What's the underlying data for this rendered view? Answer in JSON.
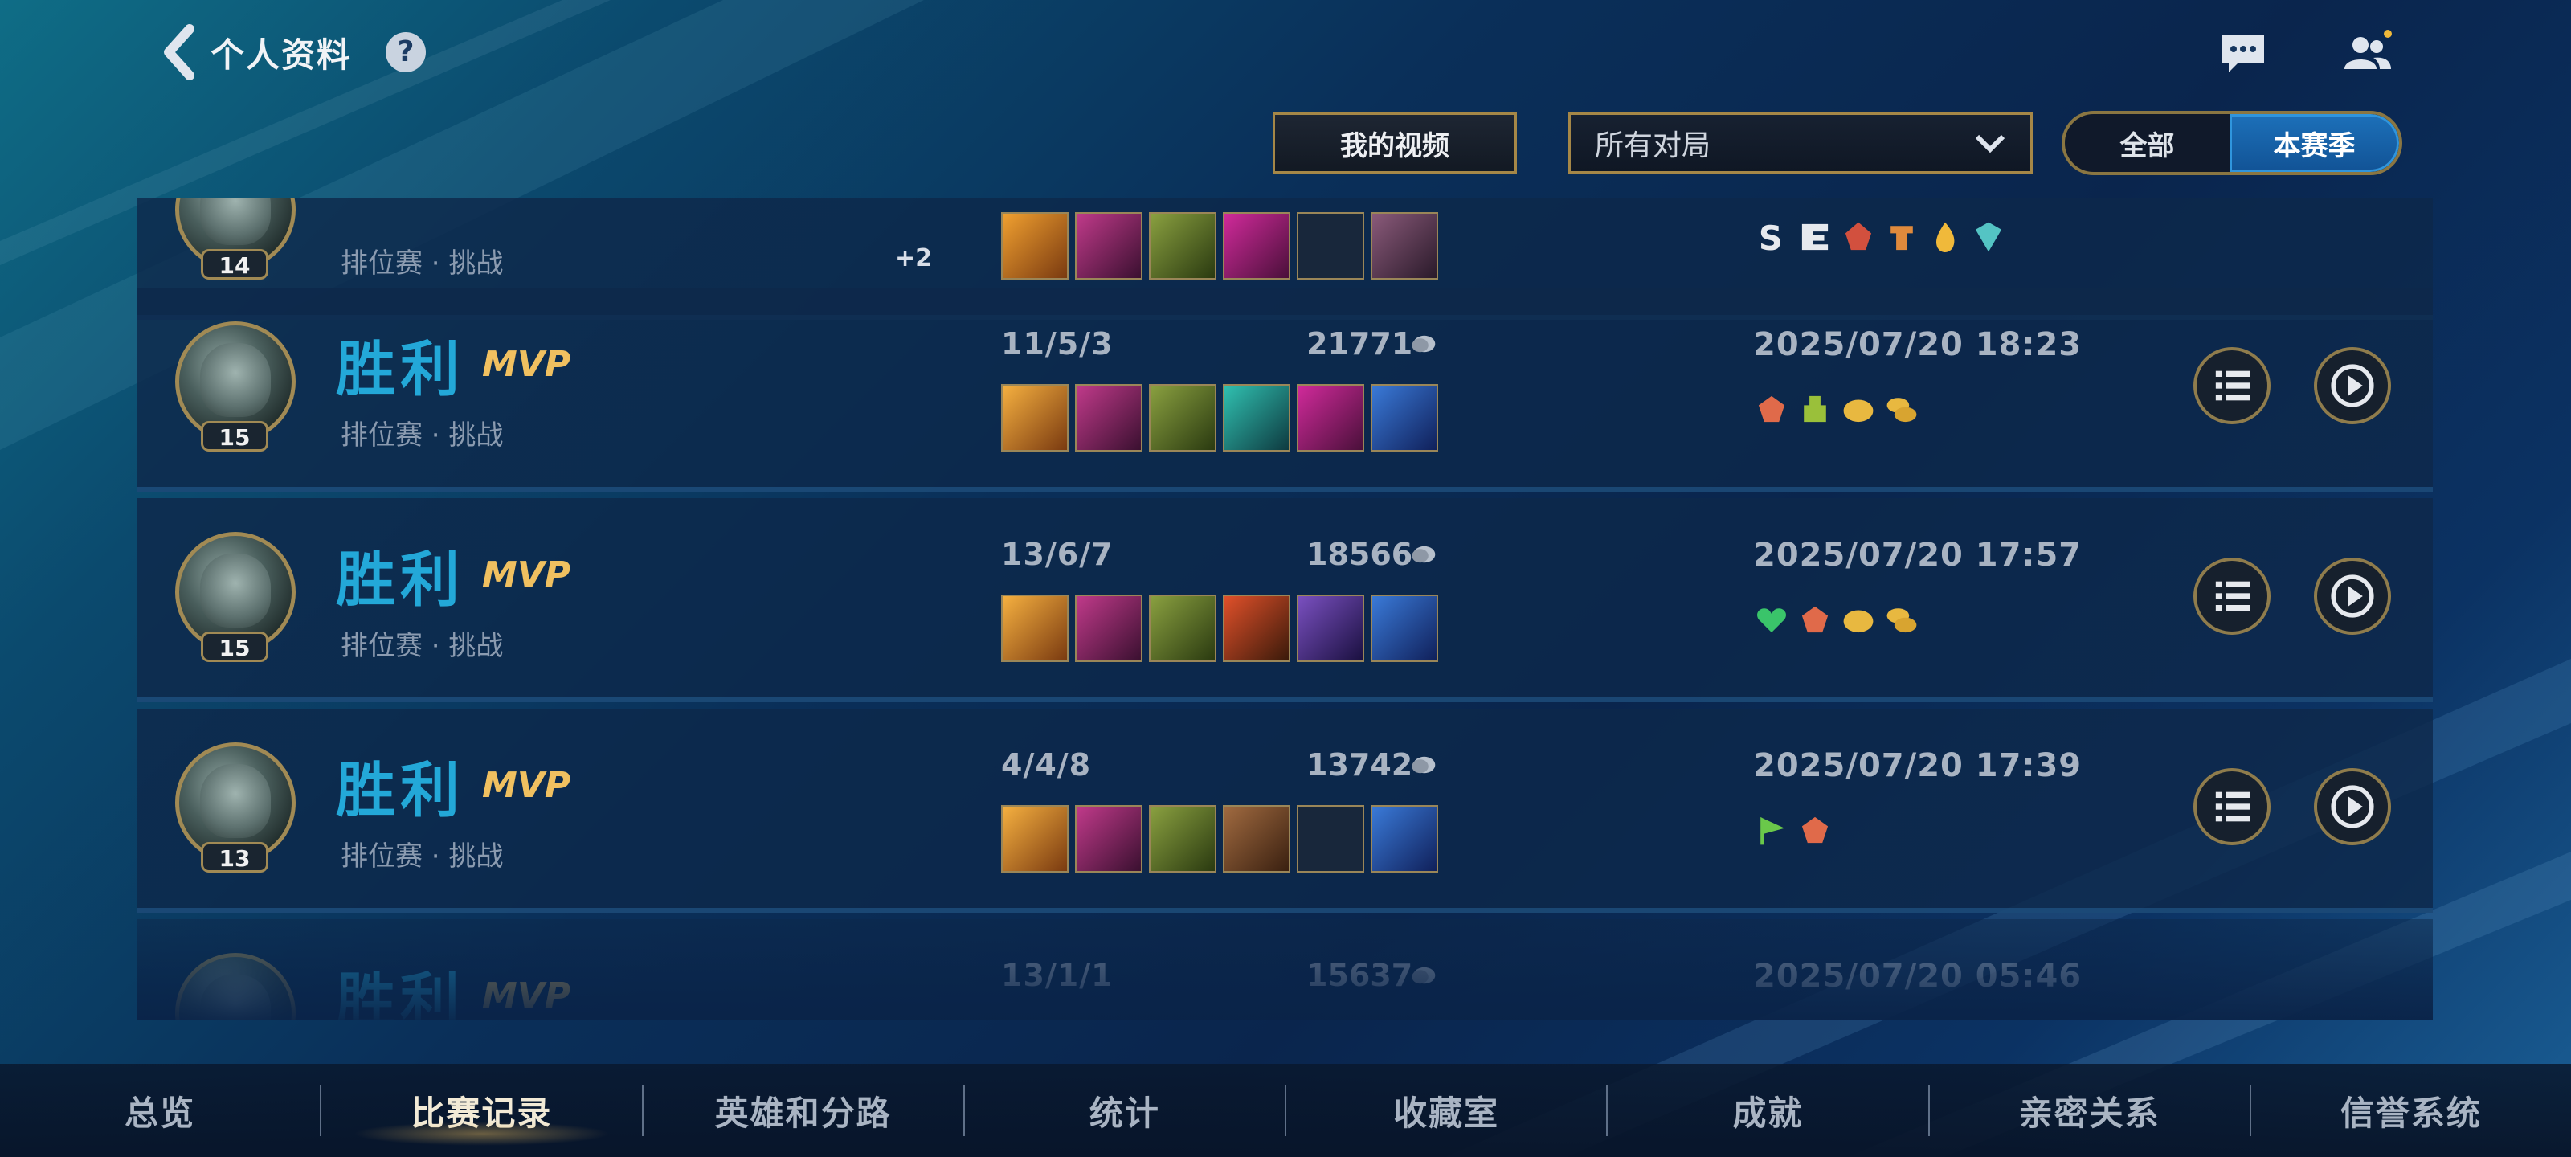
{
  "header": {
    "back_label": "个人资料",
    "help_glyph": "?"
  },
  "toolbar": {
    "my_videos": "我的视频",
    "filter_value": "所有对局",
    "season_all": "全部",
    "season_current": "本赛季"
  },
  "matches": [
    {
      "result": "",
      "mvp": "",
      "mode": "排位赛 · 挑战",
      "level": "14",
      "kda": "",
      "gold": "",
      "datetime": "",
      "extra": "+2"
    },
    {
      "result": "胜利",
      "mvp": "MVP",
      "mode": "排位赛 · 挑战",
      "level": "15",
      "kda": "11/5/3",
      "gold": "21771",
      "datetime": "2025/07/20 18:23"
    },
    {
      "result": "胜利",
      "mvp": "MVP",
      "mode": "排位赛 · 挑战",
      "level": "15",
      "kda": "13/6/7",
      "gold": "18566",
      "datetime": "2025/07/20 17:57"
    },
    {
      "result": "胜利",
      "mvp": "MVP",
      "mode": "排位赛 · 挑战",
      "level": "13",
      "kda": "4/4/8",
      "gold": "13742",
      "datetime": "2025/07/20 17:39"
    },
    {
      "result": "胜利",
      "mvp": "MVP",
      "mode": "",
      "level": "",
      "kda": "13/1/1",
      "gold": "15637",
      "datetime": "2025/07/20 05:46"
    }
  ],
  "tabs": [
    {
      "label": "总览"
    },
    {
      "label": "比赛记录",
      "active": true
    },
    {
      "label": "英雄和分路"
    },
    {
      "label": "统计"
    },
    {
      "label": "收藏室"
    },
    {
      "label": "成就"
    },
    {
      "label": "亲密关系"
    },
    {
      "label": "信誉系统"
    }
  ],
  "colors": {
    "victory": "#23a8d8",
    "mvp": "#f0c060",
    "frame_gold": "#a58747",
    "active_segment": "#1c6fb8"
  },
  "icons": {
    "back": "chevron-left-icon",
    "help": "question-icon",
    "chat": "chat-bubble-icon",
    "friends": "friends-icon",
    "dropdown": "chevron-down-icon",
    "details": "list-icon",
    "replay": "play-circle-icon",
    "gold": "gold-coin-icon"
  }
}
